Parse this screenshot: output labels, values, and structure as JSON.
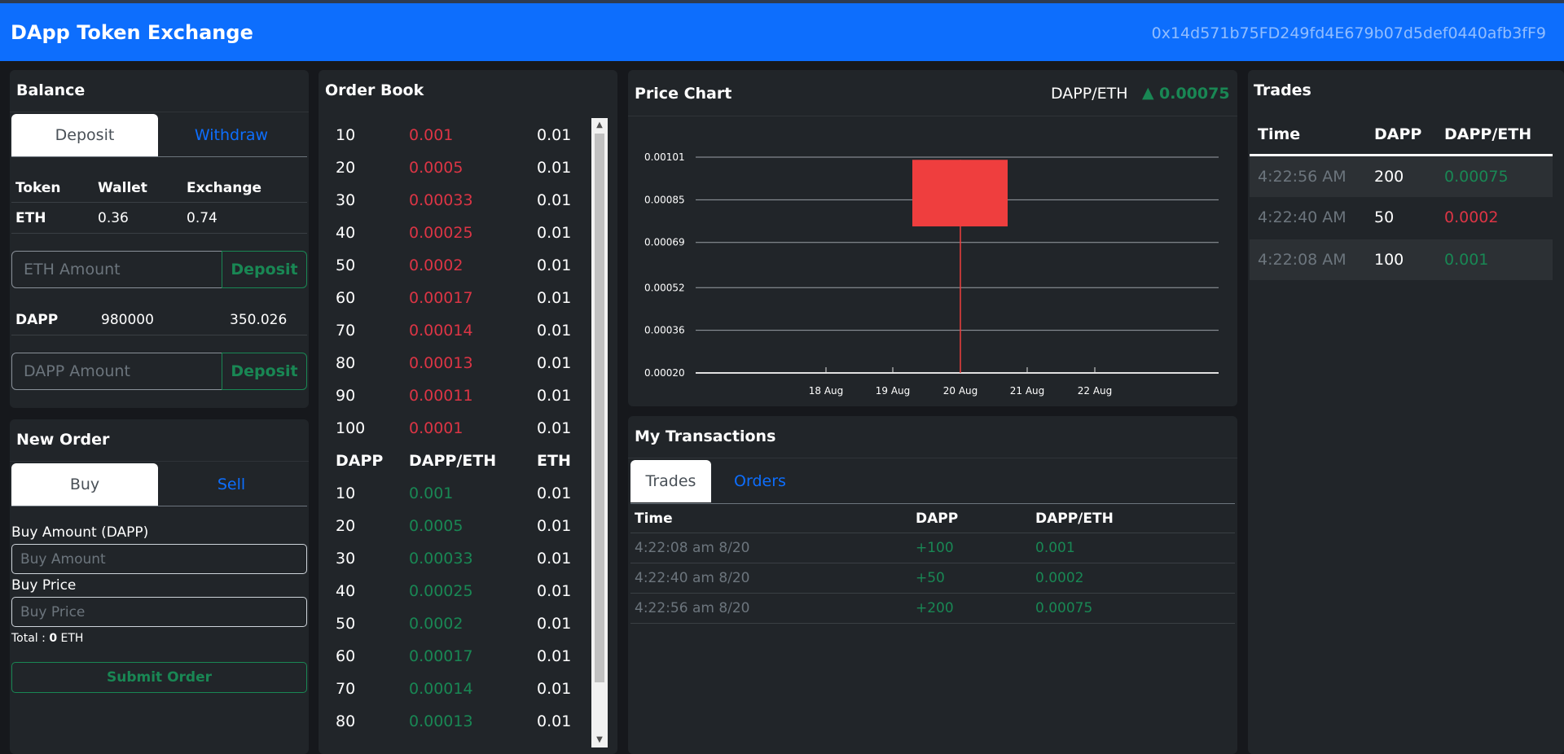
{
  "navbar": {
    "title": "DApp Token Exchange",
    "account": "0x14d571b75FD249fd4E679b07d5def0440afb3fF9"
  },
  "balance": {
    "title": "Balance",
    "tabs": [
      "Deposit",
      "Withdraw"
    ],
    "headers": [
      "Token",
      "Wallet",
      "Exchange"
    ],
    "eth": {
      "token": "ETH",
      "wallet": "0.36",
      "exchange": "0.74"
    },
    "eth_input_placeholder": "ETH Amount",
    "dapp": {
      "token": "DAPP",
      "wallet": "980000",
      "exchange": "350.026"
    },
    "dapp_input_placeholder": "DAPP Amount",
    "deposit_label": "Deposit"
  },
  "new_order": {
    "title": "New Order",
    "tabs": [
      "Buy",
      "Sell"
    ],
    "amount_label": "Buy Amount (DAPP)",
    "amount_placeholder": "Buy Amount",
    "price_label": "Buy Price",
    "price_placeholder": "Buy Price",
    "total_prefix": "Total : ",
    "total_value": "0",
    "total_suffix": " ETH",
    "submit_label": "Submit Order"
  },
  "order_book": {
    "title": "Order Book",
    "sell_orders": [
      [
        "10",
        "0.001",
        "0.01"
      ],
      [
        "20",
        "0.0005",
        "0.01"
      ],
      [
        "30",
        "0.00033",
        "0.01"
      ],
      [
        "40",
        "0.00025",
        "0.01"
      ],
      [
        "50",
        "0.0002",
        "0.01"
      ],
      [
        "60",
        "0.00017",
        "0.01"
      ],
      [
        "70",
        "0.00014",
        "0.01"
      ],
      [
        "80",
        "0.00013",
        "0.01"
      ],
      [
        "90",
        "0.00011",
        "0.01"
      ],
      [
        "100",
        "0.0001",
        "0.01"
      ]
    ],
    "headers": [
      "DAPP",
      "DAPP/ETH",
      "ETH"
    ],
    "buy_orders": [
      [
        "10",
        "0.001",
        "0.01"
      ],
      [
        "20",
        "0.0005",
        "0.01"
      ],
      [
        "30",
        "0.00033",
        "0.01"
      ],
      [
        "40",
        "0.00025",
        "0.01"
      ],
      [
        "50",
        "0.0002",
        "0.01"
      ],
      [
        "60",
        "0.00017",
        "0.01"
      ],
      [
        "70",
        "0.00014",
        "0.01"
      ],
      [
        "80",
        "0.00013",
        "0.01"
      ]
    ]
  },
  "price_chart": {
    "title": "Price Chart",
    "pair": "DAPP/ETH",
    "arrow": "▲",
    "last_price": "0.00075",
    "up_color": "#198754"
  },
  "chart_data": {
    "type": "candlestick",
    "y_ticks": [
      "0.00101",
      "0.00085",
      "0.00069",
      "0.00052",
      "0.00036",
      "0.00020"
    ],
    "x_ticks": [
      "18 Aug",
      "19 Aug",
      "20 Aug",
      "21 Aug",
      "22 Aug"
    ],
    "ylim": [
      0.0002,
      0.00101
    ],
    "candles": [
      {
        "date": "20 Aug",
        "open": 0.001,
        "high": 0.001,
        "low": 0.0002,
        "close": 0.00075
      }
    ],
    "down_color": "#ef3e3e"
  },
  "my_transactions": {
    "title": "My Transactions",
    "tabs": [
      "Trades",
      "Orders"
    ],
    "headers": [
      "Time",
      "DAPP",
      "DAPP/ETH"
    ],
    "rows": [
      [
        "4:22:08 am 8/20",
        "+100",
        "0.001"
      ],
      [
        "4:22:40 am 8/20",
        "+50",
        "0.0002"
      ],
      [
        "4:22:56 am 8/20",
        "+200",
        "0.00075"
      ]
    ]
  },
  "trades": {
    "title": "Trades",
    "headers": [
      "Time",
      "DAPP",
      "DAPP/ETH"
    ],
    "rows": [
      {
        "time": "4:22:56 AM",
        "dapp": "200",
        "price": "0.00075",
        "dir": "green"
      },
      {
        "time": "4:22:40 AM",
        "dapp": "50",
        "price": "0.0002",
        "dir": "red"
      },
      {
        "time": "4:22:08 AM",
        "dapp": "100",
        "price": "0.001",
        "dir": "green"
      }
    ]
  }
}
